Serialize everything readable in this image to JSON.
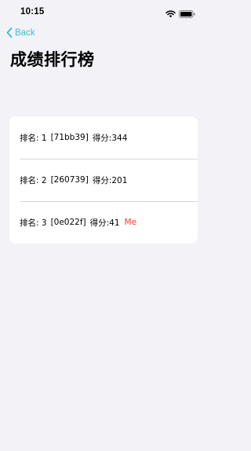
{
  "status_bar": {
    "time": "10:15",
    "icons": [
      "wifi-icon",
      "battery-icon"
    ]
  },
  "nav": {
    "back_label": "Back",
    "back_icon": "chevron-left-icon",
    "accent_color": "#34c1c7"
  },
  "page": {
    "title": "成绩排行榜"
  },
  "leaderboard": {
    "rows": [
      {
        "rank_label": "排名: 1",
        "id": "[71bb39]",
        "score_label": "得分:344",
        "tag": ""
      },
      {
        "rank_label": "排名: 2",
        "id": "[260739]",
        "score_label": "得分:201",
        "tag": ""
      },
      {
        "rank_label": "排名: 3",
        "id": "[0e022f]",
        "score_label": "得分:41",
        "tag": "Me"
      }
    ],
    "me_color": "#ff3b30"
  }
}
